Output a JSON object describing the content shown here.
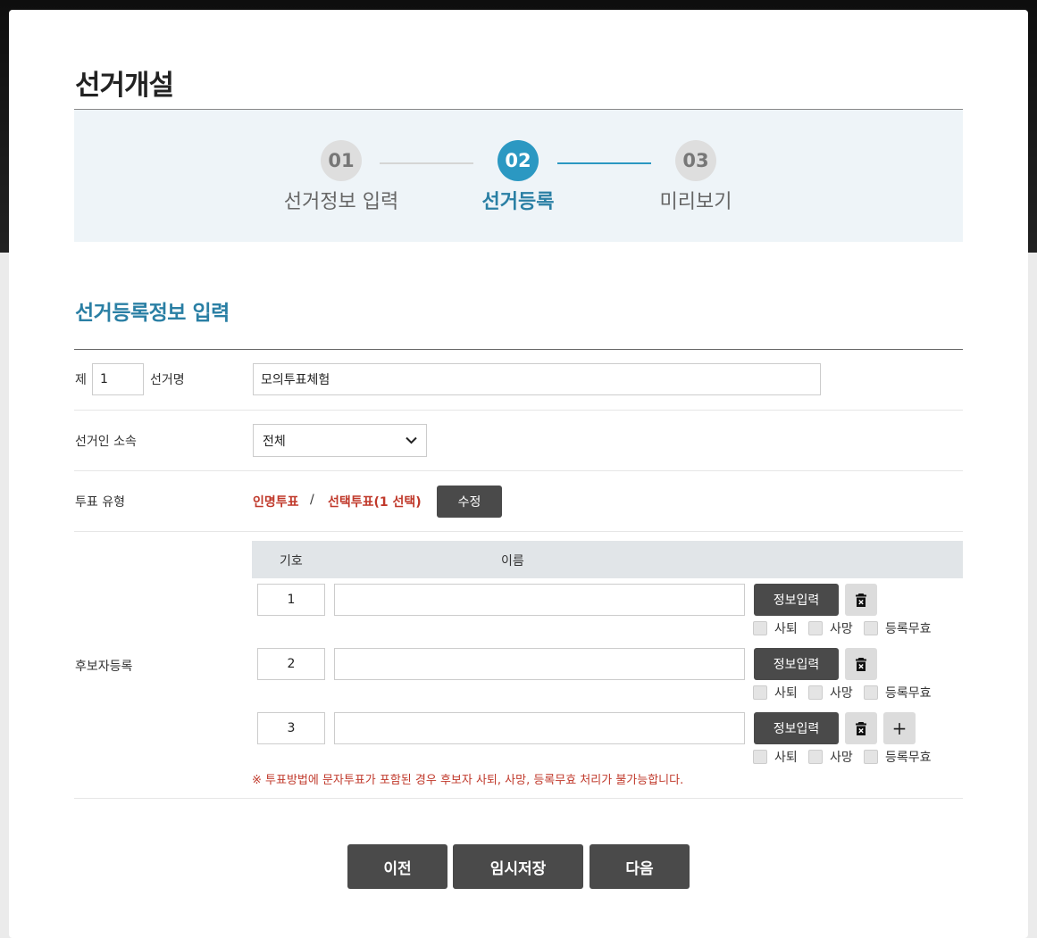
{
  "page": {
    "title": "선거개설"
  },
  "stepper": {
    "steps": [
      {
        "number": "01",
        "label": "선거정보 입력",
        "state": "done"
      },
      {
        "number": "02",
        "label": "선거등록",
        "state": "active"
      },
      {
        "number": "03",
        "label": "미리보기",
        "state": "pending"
      }
    ]
  },
  "section": {
    "title": "선거등록정보 입력"
  },
  "form": {
    "election_name": {
      "prefix": "제",
      "order_value": "1",
      "label": "선거명",
      "value": "모의투표체험"
    },
    "affiliation": {
      "label": "선거인 소속",
      "selected": "전체"
    },
    "vote_type": {
      "label": "투표 유형",
      "type1": "인명투표",
      "separator": "/",
      "type2": "선택투표(1 선택)",
      "edit_label": "수정"
    },
    "candidates": {
      "label": "후보자등록",
      "col_symbol": "기호",
      "col_name": "이름",
      "info_button_label": "정보입력",
      "resign_label": "사퇴",
      "death_label": "사망",
      "invalid_label": "등록무효",
      "add_label": "+",
      "rows": [
        {
          "symbol": "1",
          "name": ""
        },
        {
          "symbol": "2",
          "name": ""
        },
        {
          "symbol": "3",
          "name": ""
        }
      ],
      "notice": "※ 투표방법에 문자투표가 포함된 경우 후보자 사퇴, 사망, 등록무효 처리가 불가능합니다."
    }
  },
  "footer": {
    "prev_label": "이전",
    "save_label": "임시저장",
    "next_label": "다음"
  },
  "colors": {
    "accent": "#2b98c2",
    "section_title": "#2a7fa4",
    "danger_text": "#c0392b",
    "dark_button": "#4a4a4a"
  }
}
